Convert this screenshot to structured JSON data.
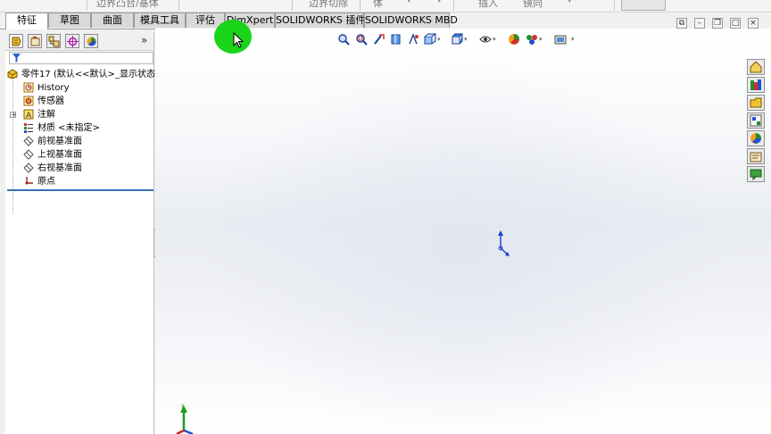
{
  "top_toolbar": {
    "fragments": [
      "边界凸台/基体",
      "边界切除",
      "体",
      "插入",
      "镜向"
    ]
  },
  "command_tabs": [
    {
      "label": "特征",
      "active": true
    },
    {
      "label": "草图",
      "active": false
    },
    {
      "label": "曲面",
      "active": false
    },
    {
      "label": "模具工具",
      "active": false
    },
    {
      "label": "评估",
      "active": false
    },
    {
      "label": "DimXpert",
      "active": false
    },
    {
      "label": "SOLIDWORKS 插件",
      "active": false
    },
    {
      "label": "SOLIDWORKS MBD",
      "active": false
    }
  ],
  "manager_tabs": [
    {
      "icon": "feature-manager-icon"
    },
    {
      "icon": "property-manager-icon"
    },
    {
      "icon": "configuration-manager-icon"
    },
    {
      "icon": "dimxpert-manager-icon"
    },
    {
      "icon": "display-manager-icon"
    }
  ],
  "manager_more": "»",
  "tree": {
    "root": "零件17 (默认<<默认>_显示状态",
    "items": [
      {
        "label": "History",
        "icon": "history-icon"
      },
      {
        "label": "传感器",
        "icon": "sensors-icon"
      },
      {
        "label": "注解",
        "icon": "annotations-icon"
      },
      {
        "label": "材质 <未指定>",
        "icon": "material-icon"
      },
      {
        "label": "前视基准面",
        "icon": "plane-icon"
      },
      {
        "label": "上视基准面",
        "icon": "plane-icon"
      },
      {
        "label": "右视基准面",
        "icon": "plane-icon"
      },
      {
        "label": "原点",
        "icon": "origin-icon"
      }
    ]
  },
  "heads_up_toolbar": [
    "zoom-to-fit-icon",
    "zoom-to-area-icon",
    "previous-view-icon",
    "section-view-icon",
    "dynamic-annotation-icon",
    "view-orientation-icon",
    "display-style-icon",
    "hide-show-items-icon",
    "edit-appearance-icon",
    "apply-scene-icon",
    "view-settings-icon"
  ],
  "task_pane": [
    "solidworks-resources-icon",
    "design-library-icon",
    "file-explorer-icon",
    "view-palette-icon",
    "appearances-icon",
    "custom-properties-icon",
    "forum-icon"
  ],
  "colors": {
    "highlight": "#19d419",
    "rollback_bar": "#3a6fb5",
    "origin_blue": "#1a3fd6",
    "axis_red": "#d42020",
    "axis_green": "#1a9a1a"
  }
}
